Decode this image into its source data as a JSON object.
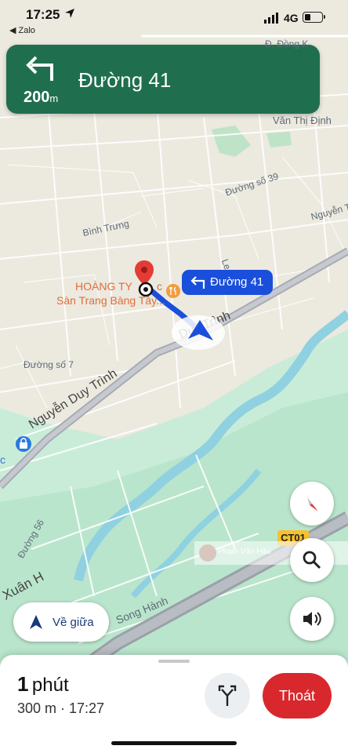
{
  "status_bar": {
    "time": "17:25",
    "back_app": "◀ Zalo",
    "network": "4G"
  },
  "navigation": {
    "distance_value": "200",
    "distance_unit": "m",
    "street_name": "Đường 41",
    "route_chip_label": "Đường 41"
  },
  "map": {
    "labels": {
      "dong_ky": "Đ. Đồng K",
      "van_thi_dinh": "Văn Thị Định",
      "duong_so_39": "Đường số 39",
      "nguyen_tu": "Nguyễn Tư",
      "binh_trung": "Bình Trưng",
      "le": "Le",
      "duong_so_7": "Đường số 7",
      "duong_56": "Đường 56",
      "song_hanh": "Song Hành",
      "trinh_top": "Trinh",
      "c_mark": "c"
    },
    "roads": {
      "nguyen_duy_trinh": "Nguyễn Duy Trình",
      "duy_trinh": "Duy Trình",
      "xuan_h": "Xuân H"
    },
    "poi": {
      "line1": "HOÀNG TY",
      "line1_suffix": "c",
      "line2": "Sàn Trang Bàng Tây..."
    },
    "ct_badge": "CT01",
    "watermark": "Phạm Văn Hậu"
  },
  "controls": {
    "recenter_label": "Về giữa"
  },
  "trip": {
    "eta_value": "1",
    "eta_unit": "phút",
    "distance_arrival": "300 m · 17:27",
    "exit_label": "Thoát"
  },
  "colors": {
    "nav_banner": "#1f6f4f",
    "route_blue": "#1a4fdc",
    "exit_red": "#d9282d",
    "river": "#8fd1e0",
    "park_green": "#b6e3c9"
  },
  "icons": [
    "location-arrow-icon",
    "signal-icon",
    "battery-icon",
    "turn-left-icon",
    "pin-icon",
    "restaurant-icon",
    "navigation-arrow-icon",
    "compass-icon",
    "search-icon",
    "volume-icon",
    "recenter-arrow-icon",
    "alternate-routes-icon",
    "lock-icon"
  ]
}
